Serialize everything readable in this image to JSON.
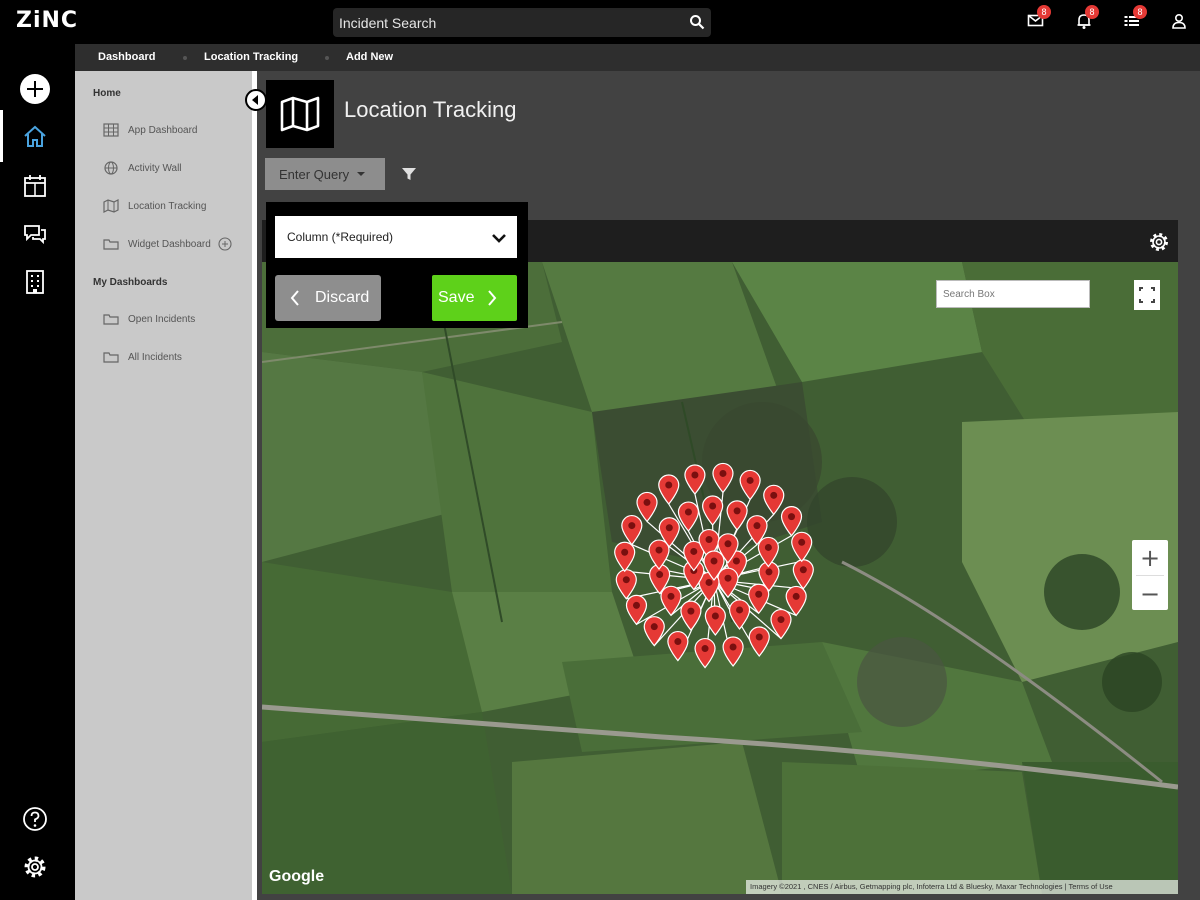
{
  "app": {
    "logo": "ZiNC"
  },
  "search": {
    "placeholder": "Incident Search"
  },
  "header_icons": [
    {
      "icon": "mail-icon",
      "badge": "8"
    },
    {
      "icon": "bell-icon",
      "badge": "8"
    },
    {
      "icon": "tasks-icon",
      "badge": "8"
    },
    {
      "icon": "user-icon"
    }
  ],
  "breadcrumb": [
    "Dashboard",
    "Location Tracking",
    "Add New"
  ],
  "sidebar": {
    "section_home": "Home",
    "home_items": [
      {
        "label": "App Dashboard",
        "icon": "grid-icon"
      },
      {
        "label": "Activity Wall",
        "icon": "globe-icon"
      },
      {
        "label": "Location Tracking",
        "icon": "map-icon"
      },
      {
        "label": "Widget Dashboard",
        "icon": "folder-icon"
      }
    ],
    "section_my": "My Dashboards",
    "my_items": [
      {
        "label": "Open Incidents",
        "icon": "folder-icon"
      },
      {
        "label": "All Incidents",
        "icon": "folder-icon"
      }
    ]
  },
  "page": {
    "title": "Location Tracking",
    "query_button": "Enter Query"
  },
  "popup": {
    "column_select": "Column (*Required)",
    "discard": "Discard",
    "save": "Save"
  },
  "map": {
    "search_placeholder": "Search Box",
    "zoom_in": "+",
    "zoom_out": "−",
    "provider": "Google",
    "attribution": "Imagery ©2021 , CNES / Airbus, Getmapping plc, Infoterra Ltd & Bluesky, Maxar Technologies | Terms of Use",
    "marker_color": "#e53935"
  },
  "colors": {
    "save_green": "#5ed11a",
    "badge_red": "#e53935"
  }
}
